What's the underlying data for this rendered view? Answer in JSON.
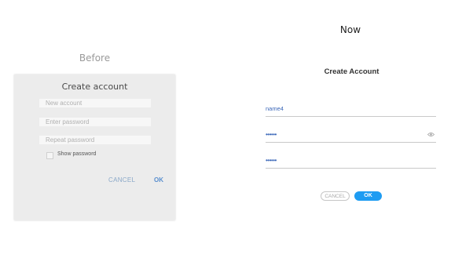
{
  "before": {
    "heading": "Before",
    "dialog": {
      "title": "Create account",
      "fields": [
        {
          "placeholder": "New account"
        },
        {
          "placeholder": "Enter password"
        },
        {
          "placeholder": "Repeat password"
        }
      ],
      "show_password_label": "Show password",
      "show_password_checked": false,
      "cancel_label": "CANCEL",
      "ok_label": "OK"
    }
  },
  "now": {
    "heading": "Now",
    "dialog": {
      "title": "Create Account",
      "fields": [
        {
          "value": "name4"
        },
        {
          "value": "••••••",
          "icon": "eye-icon"
        },
        {
          "value": "••••••"
        }
      ],
      "cancel_label": "CANCEL",
      "ok_label": "OK"
    }
  },
  "colors": {
    "accent": "#1e9cf2",
    "link_text": "#3a66b8",
    "before_dialog_bg": "#ececec"
  }
}
